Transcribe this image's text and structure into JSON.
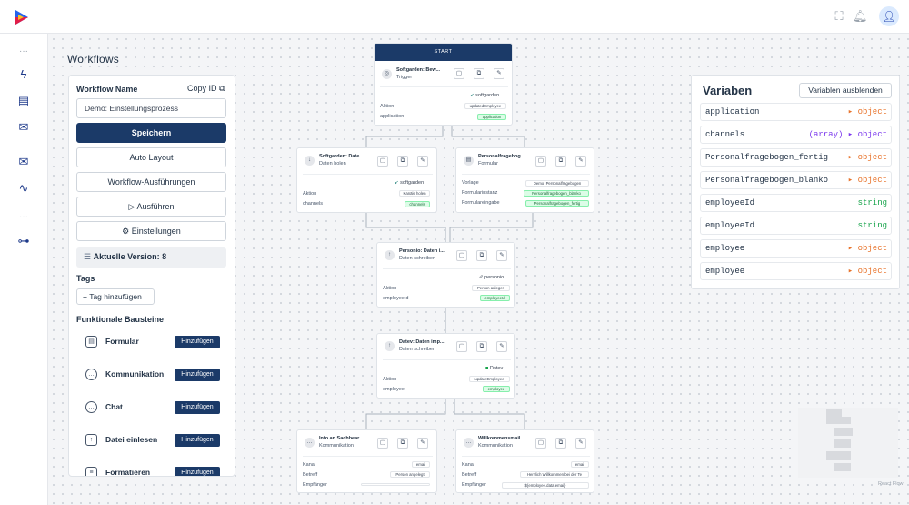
{
  "topbar": {
    "icons": [
      "fullscreen-icon",
      "bell-icon",
      "user-avatar-icon"
    ]
  },
  "leftnav": {
    "icons": [
      "more-dots-icon",
      "lightning-icon",
      "document-icon",
      "mail-icon",
      "mail-icon",
      "activity-icon",
      "more-dots-icon",
      "settings-slider-icon"
    ]
  },
  "page_title": "Workflows",
  "panel": {
    "name_label": "Workflow Name",
    "copy_id": "Copy ID",
    "name_value": "Demo: Einstellungsprozess",
    "save": "Speichern",
    "auto_layout": "Auto Layout",
    "executions": "Workflow-Ausführungen",
    "run": "Ausführen",
    "settings": "Einstellungen",
    "version": "Aktuelle Version: 8",
    "tags_label": "Tags",
    "add_tag": "Tag hinzufügen",
    "blocks_label": "Funktionale Bausteine",
    "blocks": [
      {
        "name": "Formular",
        "button": "Hinzufügen"
      },
      {
        "name": "Kommunikation",
        "button": "Hinzufügen"
      },
      {
        "name": "Chat",
        "button": "Hinzufügen"
      },
      {
        "name": "Datei einlesen",
        "button": "Hinzufügen"
      },
      {
        "name": "Formatieren",
        "button": "Hinzufügen"
      }
    ]
  },
  "nodes": {
    "start": {
      "header": "START",
      "title": "Softgarden: Bew...",
      "subtitle": "Trigger",
      "provider": "softgarden",
      "rows": [
        {
          "label": "Aktion",
          "value": "updatedEmployee"
        },
        {
          "label": "application",
          "value": "application"
        }
      ]
    },
    "softgarden_daten": {
      "title": "Softgarden: Date...",
      "subtitle": "Daten holen",
      "provider": "softgarden",
      "rows": [
        {
          "label": "Aktion",
          "value": "Kanäle holen"
        },
        {
          "label": "channels",
          "value": "channels"
        }
      ]
    },
    "personalfragebogen": {
      "title": "Personalfragebog...",
      "subtitle": "Formular",
      "rows": [
        {
          "label": "Vorlage",
          "value": "Demo: Personalfragebogen"
        },
        {
          "label": "Formularinstanz",
          "value": "Personalfragebogen_blanko"
        },
        {
          "label": "Formulareingabe",
          "value": "Personalfragebogen_fertig"
        }
      ]
    },
    "personio": {
      "title": "Personio: Daten i...",
      "subtitle": "Daten schreiben",
      "provider": "personio",
      "rows": [
        {
          "label": "Aktion",
          "value": "Person anlegen"
        },
        {
          "label": "employeeId",
          "value": "employeeId"
        }
      ]
    },
    "datev": {
      "title": "Datev: Daten imp...",
      "subtitle": "Daten schreiben",
      "provider": "Datev",
      "rows": [
        {
          "label": "Aktion",
          "value": "updateEmployee"
        },
        {
          "label": "employee",
          "value": "employee"
        }
      ]
    },
    "info_sachbearbeiter": {
      "title": "Info an Sachbear...",
      "subtitle": "Kommunikation",
      "rows": [
        {
          "label": "Kanal",
          "value": "email"
        },
        {
          "label": "Betreff",
          "value": "Person angelegt"
        },
        {
          "label": "Empfänger",
          "value": ""
        }
      ]
    },
    "willkommen": {
      "title": "Willkommensmail...",
      "subtitle": "Kommunikation",
      "rows": [
        {
          "label": "Kanal",
          "value": "email"
        },
        {
          "label": "Betreff",
          "value": "Herzlich Willkommen bei der Te"
        },
        {
          "label": "Empfänger",
          "value": "${employee.data.email}"
        }
      ]
    }
  },
  "variables": {
    "title": "Variaben",
    "hide_button": "Variablen ausblenden",
    "items": [
      {
        "name": "application",
        "type": "▸ object"
      },
      {
        "name": "channels",
        "type": "(array) ▸ object"
      },
      {
        "name": "Personalfragebogen_fertig",
        "type": "▸ object"
      },
      {
        "name": "Personalfragebogen_blanko",
        "type": "▸ object"
      },
      {
        "name": "employeeId",
        "type": "string"
      },
      {
        "name": "employeeId",
        "type": "string"
      },
      {
        "name": "employee",
        "type": "▸ object"
      },
      {
        "name": "employee",
        "type": "▸ object"
      }
    ]
  },
  "attribution": "React Flow",
  "colors": {
    "primary": "#1b3a68",
    "green": "#16a34a",
    "orange": "#e8732b",
    "purple": "#7c3aed"
  }
}
